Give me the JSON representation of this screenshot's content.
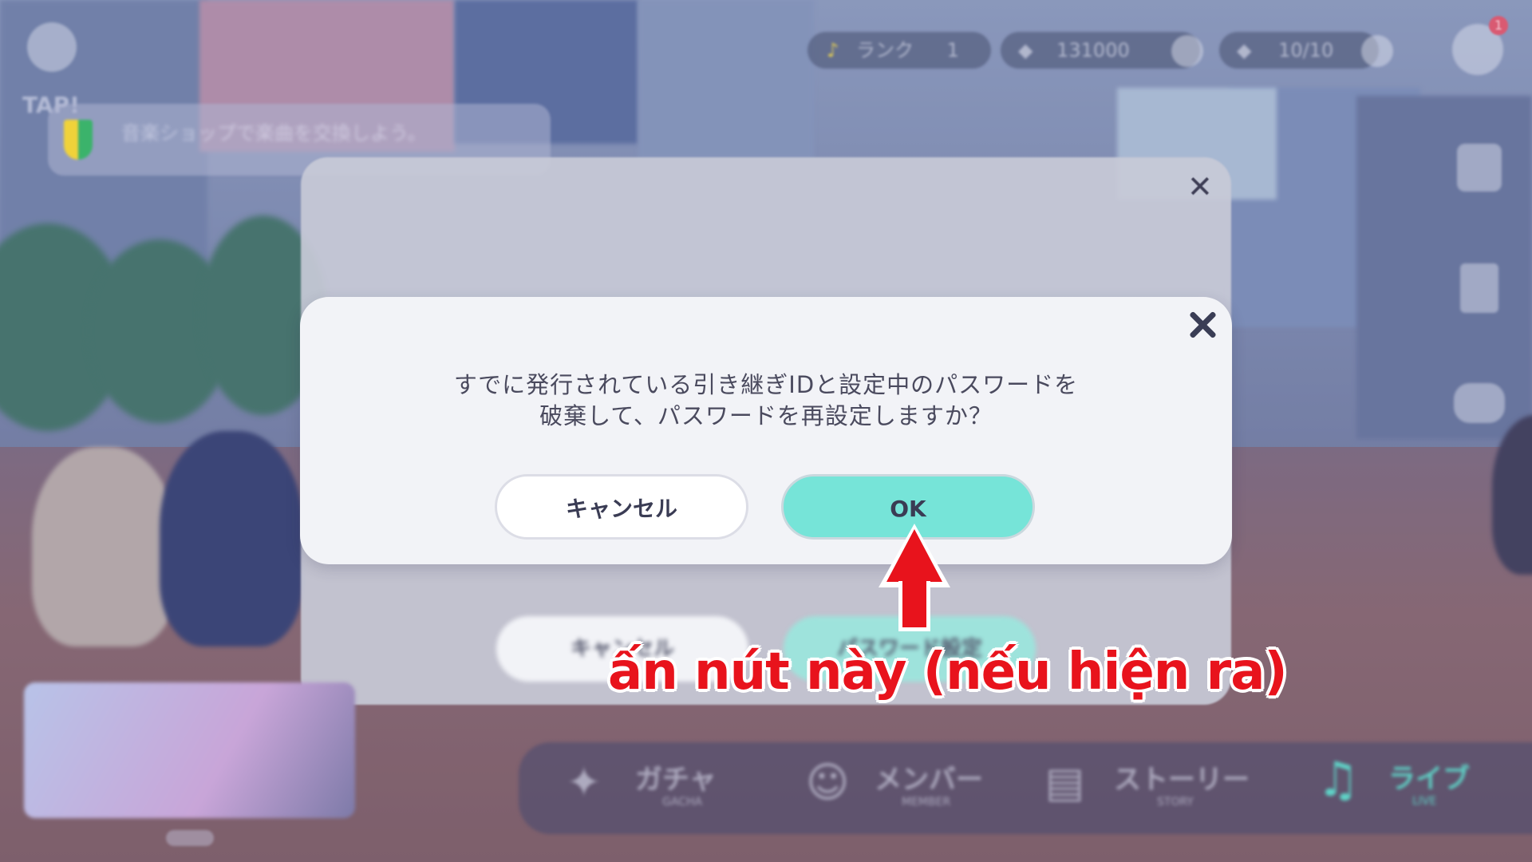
{
  "hud": {
    "rank_label": "ランク",
    "rank_value": "1",
    "currency_value": "131000",
    "stamina_value": "10/10",
    "notification_count": "1"
  },
  "background": {
    "mission_text": "音楽ショップで楽曲を交換しよう。",
    "tap_label": "TAP!",
    "back_dialog_cancel": "キャンセル",
    "back_dialog_confirm": "パスワード設定"
  },
  "nav": {
    "items": [
      {
        "label": "ガチャ",
        "sub": "GACHA"
      },
      {
        "label": "メンバー",
        "sub": "MEMBER"
      },
      {
        "label": "ストーリー",
        "sub": "STORY"
      },
      {
        "label": "ライブ",
        "sub": "LIVE"
      }
    ]
  },
  "dialog": {
    "message_line1": "すでに発行されている引き継ぎIDと設定中のパスワードを",
    "message_line2": "破棄して、パスワードを再設定しますか？",
    "cancel_label": "キャンセル",
    "ok_label": "OK"
  },
  "annotation": {
    "text": "ấn nút này (nếu hiện ra)"
  },
  "colors": {
    "ok_button": "#76e4d8",
    "annotation": "#e8131c"
  }
}
